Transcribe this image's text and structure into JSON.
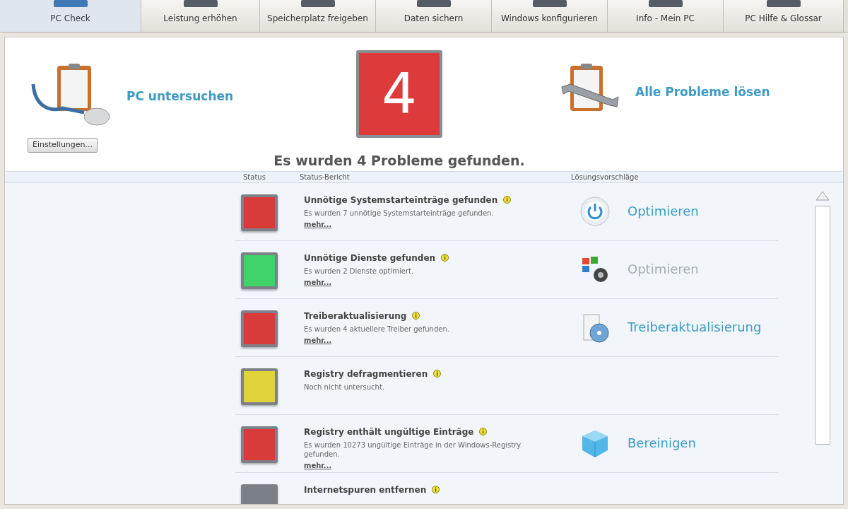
{
  "tabs": [
    {
      "label": "PC Check",
      "selected": true
    },
    {
      "label": "Leistung erhöhen",
      "selected": false
    },
    {
      "label": "Speicherplatz freigeben",
      "selected": false
    },
    {
      "label": "Daten sichern",
      "selected": false
    },
    {
      "label": "Windows konfigurieren",
      "selected": false
    },
    {
      "label": "Info - Mein PC",
      "selected": false
    },
    {
      "label": "PC Hilfe & Glossar",
      "selected": false
    }
  ],
  "scan": {
    "action": "PC untersuchen",
    "settings_button": "Einstellungen...",
    "problem_count": "4",
    "summary": "Es wurden 4 Probleme gefunden.",
    "fix_all": "Alle Probleme lösen"
  },
  "table": {
    "columns": [
      "Status",
      "Status-Bericht",
      "Lösungsvorschläge"
    ],
    "rows": [
      {
        "title": "Unnötige Systemstarteinträge gefunden",
        "detail": "Es wurden 7 unnötige Systemstarteinträge gefunden.",
        "more": "mehr...",
        "color": "#d93a3a",
        "action": {
          "kind": "power",
          "label": "Optimieren",
          "disabled": false
        }
      },
      {
        "title": "Unnötige Dienste gefunden",
        "detail": "Es wurden 2 Dienste optimiert.",
        "more": "mehr...",
        "color": "#3fd36a",
        "action": {
          "kind": "windows",
          "label": "Optimieren",
          "disabled": true
        }
      },
      {
        "title": "Treiberaktualisierung",
        "detail": "Es wurden 4 aktuellere Treiber gefunden.",
        "more": "mehr...",
        "color": "#d93a3a",
        "action": {
          "kind": "driver",
          "label": "Treiberaktualisierung",
          "disabled": false
        }
      },
      {
        "title": "Registry defragmentieren",
        "detail": "Noch nicht untersucht.",
        "color": "#e0d43a"
      },
      {
        "title": "Registry enthält ungültige Einträge",
        "detail": "Es wurden 10273 ungültige Einträge in der Windows-Registry gefunden.",
        "more": "mehr...",
        "color": "#d93a3a",
        "action": {
          "kind": "cube",
          "label": "Bereinigen",
          "disabled": false
        }
      },
      {
        "title": "Internetspuren entfernen",
        "color": "#7a7f86"
      }
    ]
  }
}
